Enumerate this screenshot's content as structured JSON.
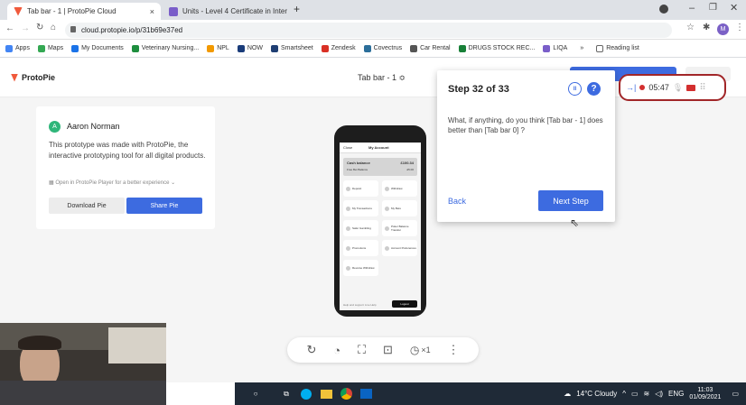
{
  "browser": {
    "tabs": [
      {
        "title": "Tab bar - 1 | ProtoPie Cloud",
        "close": "×",
        "favicon_color": "#f05a3c"
      },
      {
        "title": "Units - Level 4 Certificate in Inter",
        "close": "×",
        "favicon_color": "#7a5ec9"
      }
    ],
    "new_tab": "+",
    "url": "cloud.protopie.io/p/31b69e37ed",
    "profile_initial": "M",
    "bookmarks": [
      {
        "label": "Apps",
        "color": "#4285f4"
      },
      {
        "label": "Maps",
        "color": "#34a853"
      },
      {
        "label": "My Documents",
        "color": "#1a73e8"
      },
      {
        "label": "Veterinary Nursing...",
        "color": "#1e8e3e"
      },
      {
        "label": "NPL",
        "color": "#f29900"
      },
      {
        "label": "NOW",
        "color": "#1a3c7a"
      },
      {
        "label": "Smartsheet",
        "color": "#1f3e73"
      },
      {
        "label": "Zendesk",
        "color": "#d93025"
      },
      {
        "label": "Covectrus",
        "color": "#2b6e9a"
      },
      {
        "label": "Car Rental",
        "color": "#555555"
      },
      {
        "label": "DRUGS STOCK REC...",
        "color": "#188038"
      },
      {
        "label": "LIQA",
        "color": "#7a5ec9"
      }
    ],
    "bookmarks_more": "»",
    "reading_list": "Reading list"
  },
  "app": {
    "logo": "ProtoPie",
    "logo_color": "#f05a3c",
    "document_title": "Tab bar - 1 ≎",
    "author_initial": "A",
    "author_name": "Aaron Norman",
    "description": "This prototype was made with ProtoPie, the interactive prototyping tool for all digital products.",
    "open_hint": "Open in ProtoPie Player for a better experience",
    "download_label": "Download Pie",
    "share_label": "Share Pie",
    "accent": "#3d6be0"
  },
  "phone_screen": {
    "close": "Close",
    "title": "My Account",
    "cash_balance_label": "Cash balance",
    "cash_balance_value": "£100.34",
    "free_bet_label": "Free Bet Balance",
    "free_bet_value": "£5.00",
    "buttons": [
      "Deposit",
      "Withdraw",
      "My Transactions",
      "My Bets",
      "Safer Gambling",
      "Poker Balance Transfer",
      "Promotions",
      "Account Preferences",
      "Reverse Withdraw"
    ],
    "footer_left": "Help and support",
    "footer_mid": "Live Help",
    "footer_btn": "Logout"
  },
  "player_toolbar": {
    "replay": "↻",
    "touch": "◔",
    "fit": "⛶",
    "screen": "⊡",
    "speed": "×1",
    "more": "⋮"
  },
  "task": {
    "step_label": "Step 32 of 33",
    "question": "What, if anything, do you think [Tab bar - 1] does better than [Tab bar 0] ?",
    "back_label": "Back",
    "next_label": "Next Step",
    "pause_icon": "II",
    "help_icon": "?"
  },
  "recorder": {
    "timer": "05:47",
    "record_color": "#d32f2f"
  },
  "taskbar": {
    "weather": "14°C Cloudy",
    "lang": "ENG",
    "time": "11:03",
    "date": "01/09/2021"
  }
}
